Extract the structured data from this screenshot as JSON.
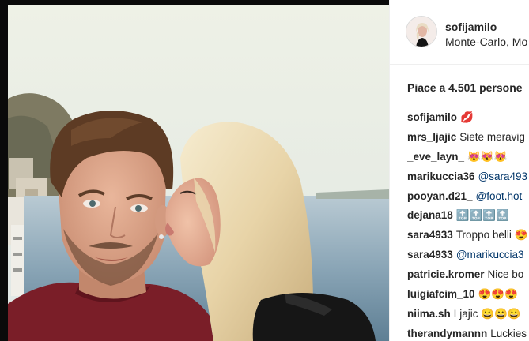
{
  "post": {
    "username": "sofijamilo",
    "location": "Monte-Carlo, Mo",
    "likes_text": "Piace a 4.501 persone"
  },
  "comments": [
    {
      "author": "sofijamilo",
      "text": "💋",
      "mention": false
    },
    {
      "author": "mrs_ljajic",
      "text": "Siete meravig",
      "mention": false
    },
    {
      "author": "_eve_layn_",
      "text": "😻😻😻",
      "mention": false
    },
    {
      "author": "marikuccia36",
      "text": "@sara493",
      "mention": true
    },
    {
      "author": "pooyan.d21_",
      "text": "@foot.hot",
      "mention": true
    },
    {
      "author": "dejana18",
      "text": "🔝🔝🔝🔝",
      "mention": false
    },
    {
      "author": "sara4933",
      "text": "Troppo belli 😍",
      "mention": false
    },
    {
      "author": "sara4933",
      "text": "@marikuccia3",
      "mention": true
    },
    {
      "author": "patricie.kromer",
      "text": "Nice bo",
      "mention": false
    },
    {
      "author": "luigiafcim_10",
      "text": "😍😍😍",
      "mention": false
    },
    {
      "author": "niima.sh",
      "text": "Ljajic 😀😀😀",
      "mention": false
    },
    {
      "author": "therandymannn",
      "text": "Luckies",
      "mention": false
    }
  ],
  "colors": {
    "text": "#262626",
    "mention": "#003569",
    "divider": "#efefef"
  }
}
